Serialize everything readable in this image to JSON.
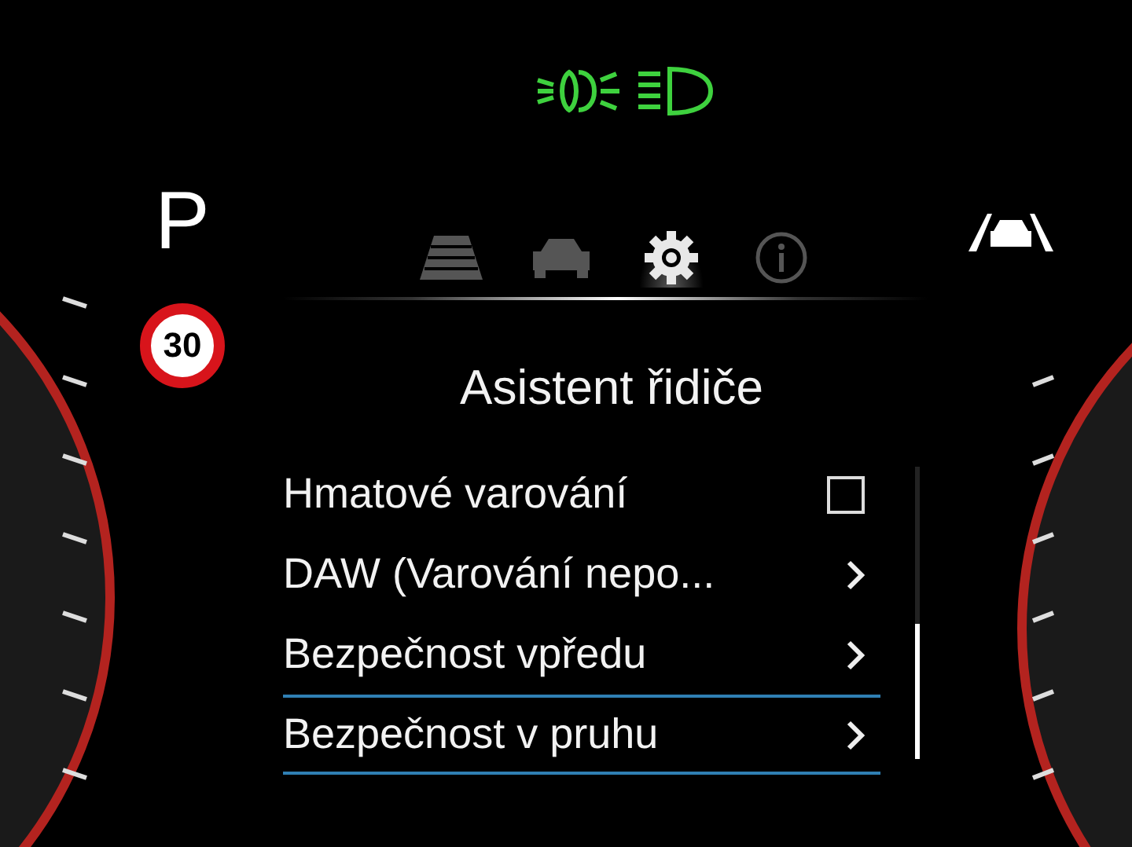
{
  "gear": "P",
  "speed_limit": "30",
  "tabs": [
    {
      "kind": "road",
      "selected": false
    },
    {
      "kind": "car",
      "selected": false
    },
    {
      "kind": "settings",
      "selected": true
    },
    {
      "kind": "info",
      "selected": false
    }
  ],
  "menu": {
    "title": "Asistent řidiče",
    "items": [
      {
        "kind": "checkbox",
        "label": "Hmatové varování",
        "checked": false,
        "selected": false
      },
      {
        "kind": "submenu",
        "label": "DAW (Varování nepo...",
        "selected": false
      },
      {
        "kind": "submenu",
        "label": "Bezpečnost vpředu",
        "selected": false
      },
      {
        "kind": "submenu",
        "label": "Bezpečnost v pruhu",
        "selected": true
      }
    ]
  }
}
